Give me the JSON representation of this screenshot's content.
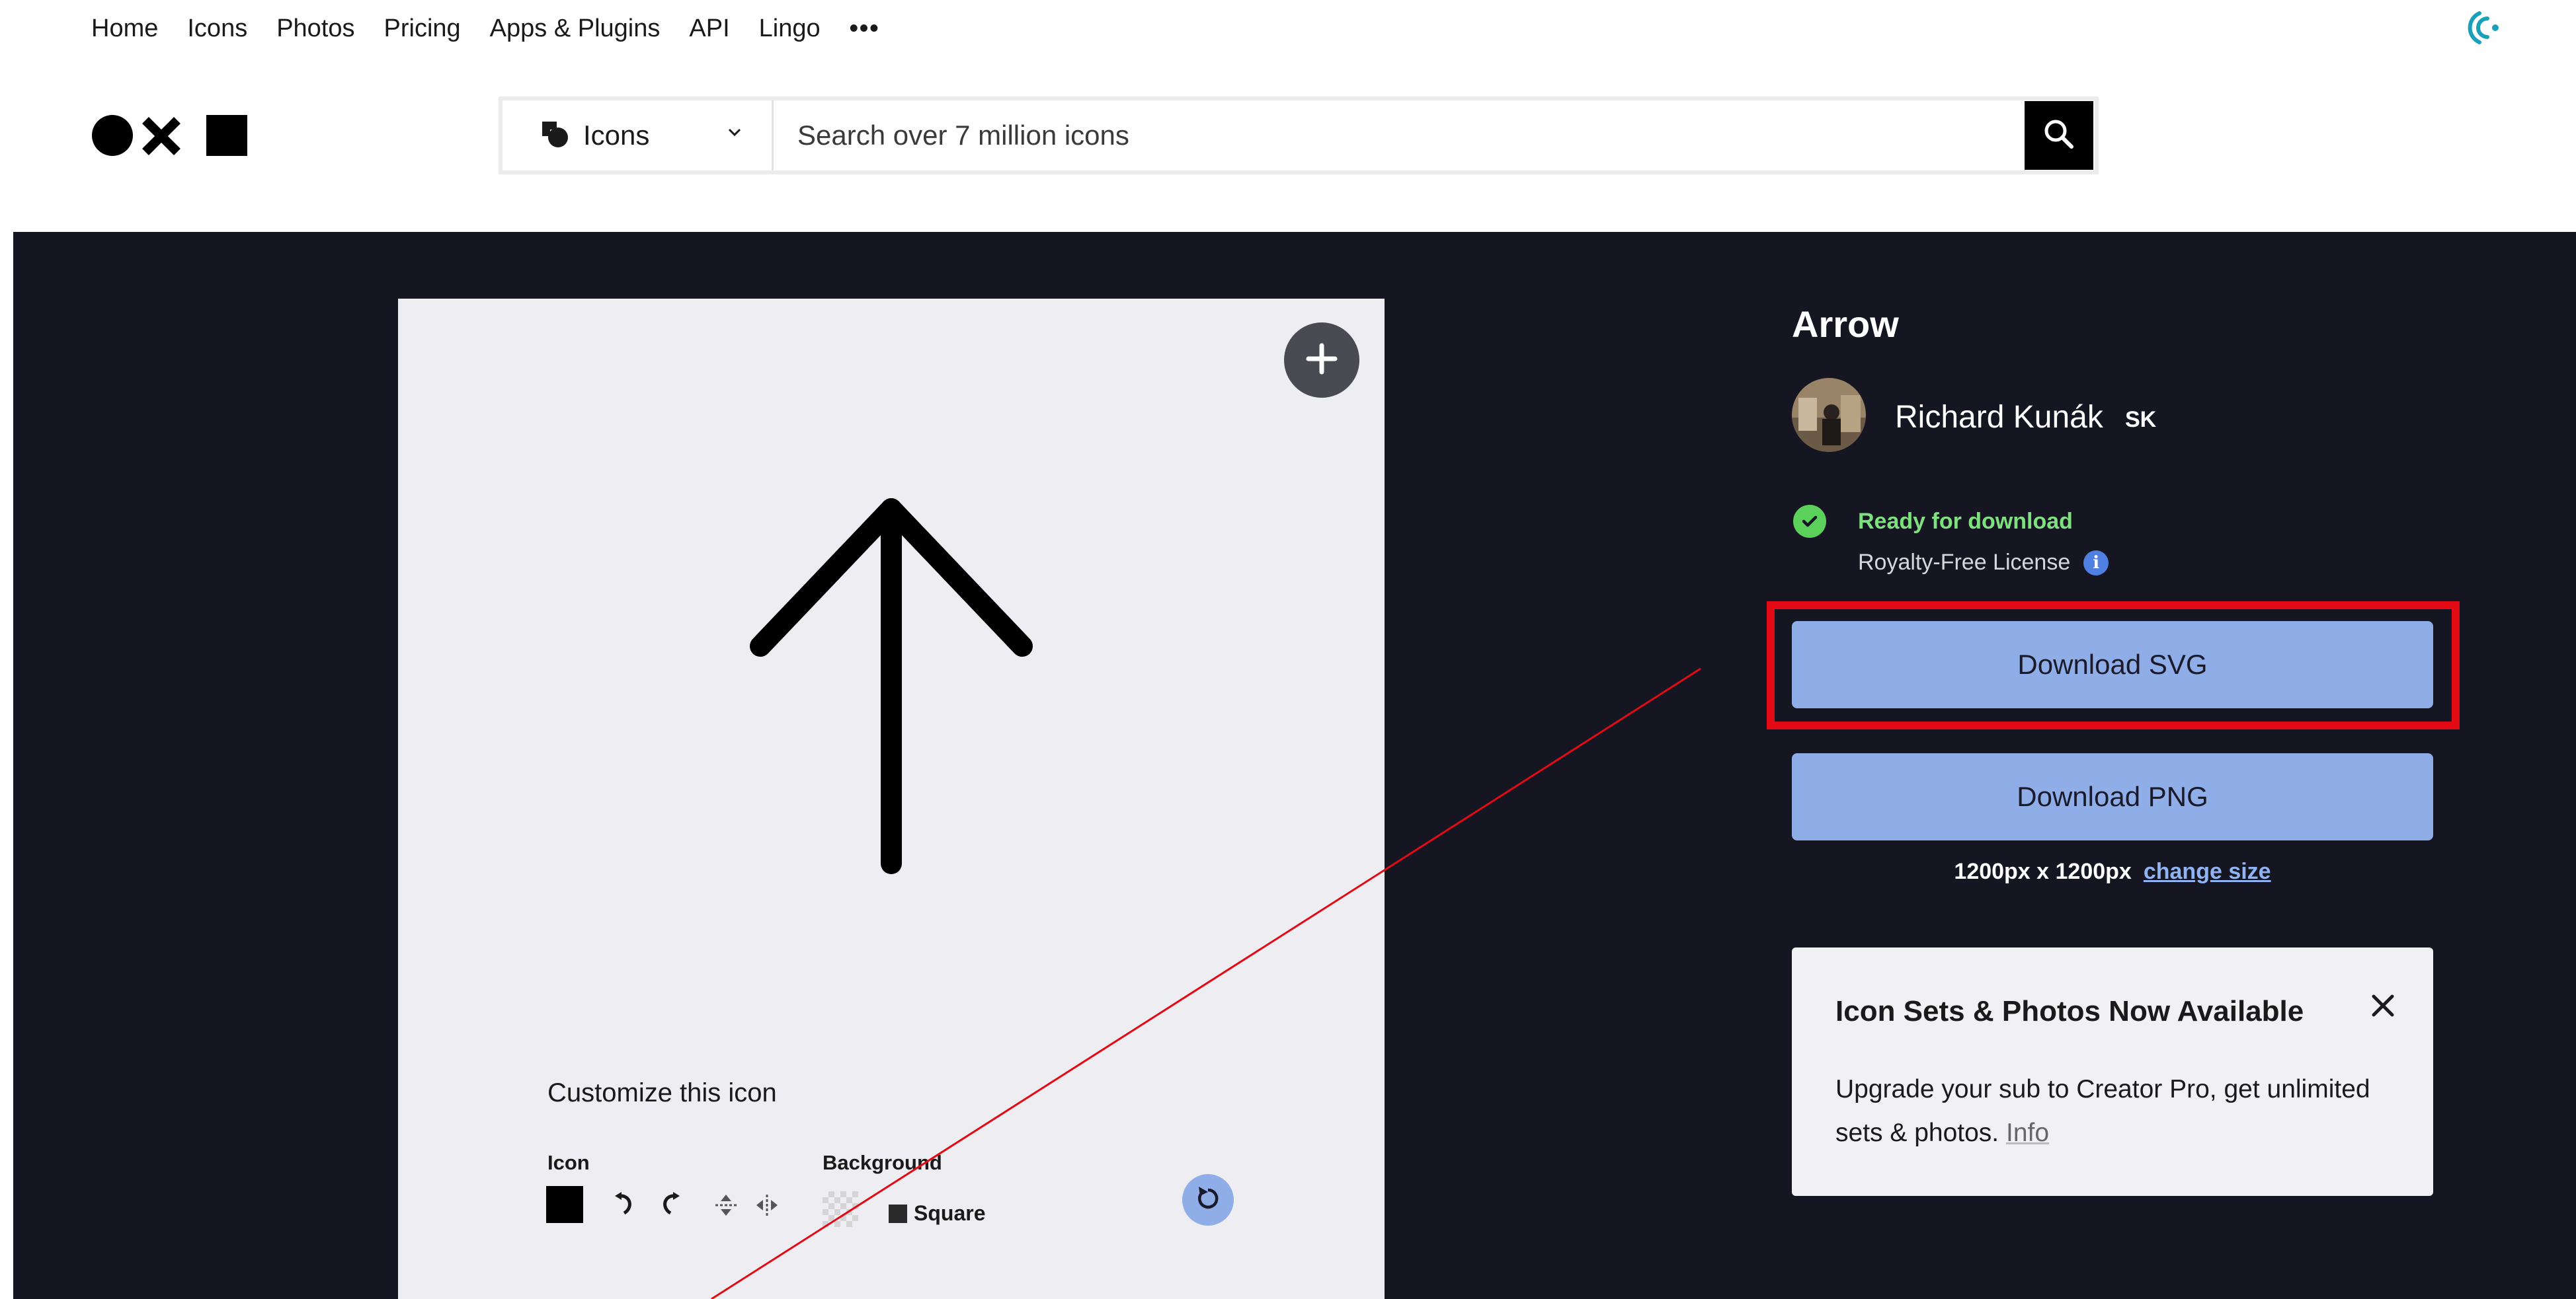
{
  "nav": {
    "items": [
      "Home",
      "Icons",
      "Photos",
      "Pricing",
      "Apps & Plugins",
      "API",
      "Lingo"
    ],
    "more": "•••"
  },
  "search": {
    "type_label": "Icons",
    "placeholder": "Search over 7 million icons"
  },
  "preview": {
    "customize_title": "Customize this icon",
    "icon_label": "Icon",
    "background_label": "Background",
    "shape_label": "Square"
  },
  "details": {
    "title": "Arrow",
    "author": "Richard Kunák",
    "country": "SK",
    "status": "Ready for download",
    "license": "Royalty-Free License",
    "download_svg": "Download SVG",
    "download_png": "Download PNG",
    "size": "1200px x 1200px",
    "change_size": "change size"
  },
  "promo": {
    "title": "Icon Sets & Photos Now Available",
    "body": "Upgrade your sub to Creator Pro, get unlimited sets & photos.",
    "info_link": "Info"
  },
  "colors": {
    "hero_bg": "#151621",
    "button": "#8faee8",
    "success": "#7fe07f",
    "highlight": "#e20a14"
  }
}
